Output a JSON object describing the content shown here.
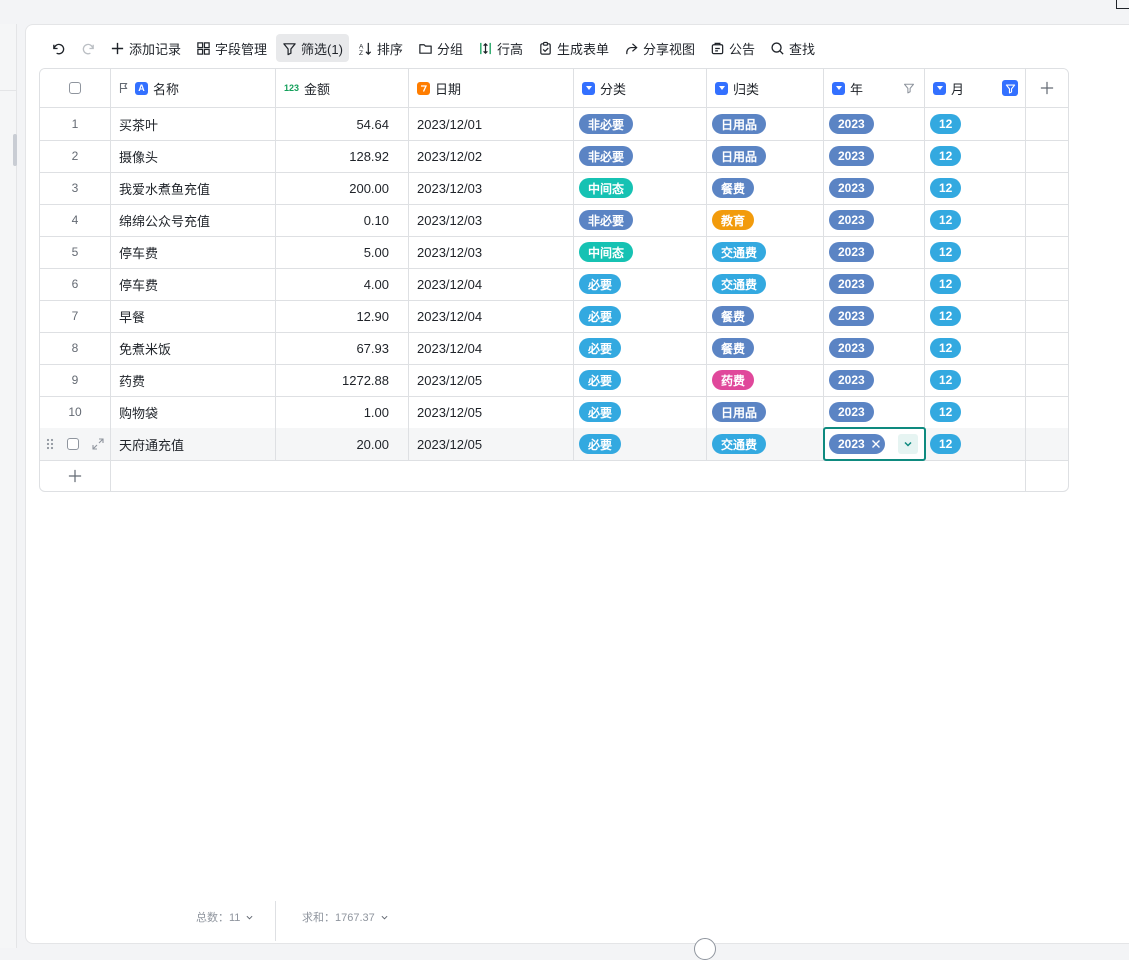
{
  "toolbar": {
    "undo": "undo",
    "redo": "redo",
    "add_record": "添加记录",
    "field_manage": "字段管理",
    "filter": "筛选(1)",
    "sort": "排序",
    "group": "分组",
    "row_height": "行高",
    "gen_form": "生成表单",
    "share_view": "分享视图",
    "notice": "公告",
    "find": "查找"
  },
  "columns": {
    "name": "名称",
    "name_type_badge": "A",
    "amount": "金额",
    "amount_type_badge": "123",
    "date": "日期",
    "category": "分类",
    "classify": "归类",
    "year": "年",
    "month": "月"
  },
  "tag_colors": {
    "非必要": "#5b84c4",
    "必要": "#33a9e0",
    "中间态": "#16c2b3",
    "日用品": "#5b84c4",
    "餐费": "#5b84c4",
    "交通费": "#33a9e0",
    "教育": "#f29b0c",
    "药费": "#e0489b",
    "2023": "#5b84c4",
    "12": "#33a9e0"
  },
  "rows": [
    {
      "idx": "1",
      "name": "买茶叶",
      "amount": "54.64",
      "date": "2023/12/01",
      "category": "非必要",
      "classify": "日用品",
      "year": "2023",
      "month": "12"
    },
    {
      "idx": "2",
      "name": "摄像头",
      "amount": "128.92",
      "date": "2023/12/02",
      "category": "非必要",
      "classify": "日用品",
      "year": "2023",
      "month": "12"
    },
    {
      "idx": "3",
      "name": "我爱水煮鱼充值",
      "amount": "200.00",
      "date": "2023/12/03",
      "category": "中间态",
      "classify": "餐费",
      "year": "2023",
      "month": "12"
    },
    {
      "idx": "4",
      "name": "绵绵公众号充值",
      "amount": "0.10",
      "date": "2023/12/03",
      "category": "非必要",
      "classify": "教育",
      "year": "2023",
      "month": "12"
    },
    {
      "idx": "5",
      "name": "停车费",
      "amount": "5.00",
      "date": "2023/12/03",
      "category": "中间态",
      "classify": "交通费",
      "year": "2023",
      "month": "12"
    },
    {
      "idx": "6",
      "name": "停车费",
      "amount": "4.00",
      "date": "2023/12/04",
      "category": "必要",
      "classify": "交通费",
      "year": "2023",
      "month": "12"
    },
    {
      "idx": "7",
      "name": "早餐",
      "amount": "12.90",
      "date": "2023/12/04",
      "category": "必要",
      "classify": "餐费",
      "year": "2023",
      "month": "12"
    },
    {
      "idx": "8",
      "name": "免煮米饭",
      "amount": "67.93",
      "date": "2023/12/04",
      "category": "必要",
      "classify": "餐费",
      "year": "2023",
      "month": "12"
    },
    {
      "idx": "9",
      "name": "药费",
      "amount": "1272.88",
      "date": "2023/12/05",
      "category": "必要",
      "classify": "药费",
      "year": "2023",
      "month": "12"
    },
    {
      "idx": "10",
      "name": "购物袋",
      "amount": "1.00",
      "date": "2023/12/05",
      "category": "必要",
      "classify": "日用品",
      "year": "2023",
      "month": "12"
    },
    {
      "idx": "",
      "name": "天府通充值",
      "amount": "20.00",
      "date": "2023/12/05",
      "category": "必要",
      "classify": "交通费",
      "year": "2023",
      "month": "12"
    }
  ],
  "stats": {
    "count": "总数：11",
    "sum": "求和：1767.37"
  }
}
